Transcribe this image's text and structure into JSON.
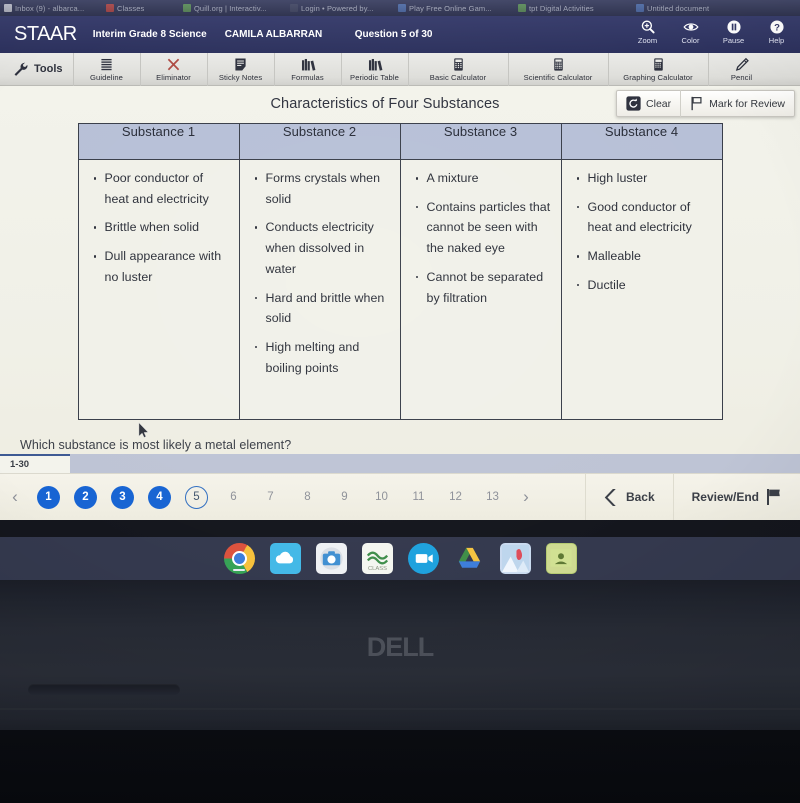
{
  "browser": {
    "tabs": [
      {
        "label": "Inbox (9) - albarca...",
        "favicon": "mail-icon",
        "favcolor": "white"
      },
      {
        "label": "Classes",
        "favicon": "classes-icon",
        "favcolor": "red"
      },
      {
        "label": "Quill.org | Interactiv...",
        "favicon": "quill-icon",
        "favcolor": "green"
      },
      {
        "label": "Login • Powered by...",
        "favicon": "login-icon",
        "favcolor": "dark"
      },
      {
        "label": "Play Free Online Gam...",
        "favicon": "play-icon",
        "favcolor": "blue"
      },
      {
        "label": "tpt Digital Activities",
        "favicon": "tpt-icon",
        "favcolor": "green"
      },
      {
        "label": "Untitled document",
        "favicon": "docs-icon",
        "favcolor": "blue"
      }
    ]
  },
  "header": {
    "logo": "STAAR",
    "test_name": "Interim Grade 8 Science",
    "student_name": "CAMILA ALBARRAN",
    "question_counter": "Question 5 of 30",
    "tools": [
      {
        "label": "Zoom",
        "icon": "zoom-in-icon"
      },
      {
        "label": "Color",
        "icon": "eye-color-icon"
      },
      {
        "label": "Pause",
        "icon": "pause-icon"
      },
      {
        "label": "Help",
        "icon": "question-mark-icon"
      }
    ]
  },
  "toolsbar": {
    "tools_label": "Tools",
    "tools_icon": "wrench-icon",
    "items": [
      {
        "label": "Guideline",
        "icon": "guideline-icon",
        "wide": false
      },
      {
        "label": "Eliminator",
        "icon": "eliminator-x-icon",
        "wide": false
      },
      {
        "label": "Sticky Notes",
        "icon": "sticky-notes-icon",
        "wide": false
      },
      {
        "label": "Formulas",
        "icon": "formulas-icon",
        "wide": false
      },
      {
        "label": "Periodic Table",
        "icon": "periodic-table-icon",
        "wide": false
      },
      {
        "label": "Basic Calculator",
        "icon": "calculator-icon",
        "wide": true
      },
      {
        "label": "Scientific Calculator",
        "icon": "calculator-icon",
        "wide": true
      },
      {
        "label": "Graphing Calculator",
        "icon": "calculator-icon",
        "wide": true
      },
      {
        "label": "Pencil",
        "icon": "pencil-icon",
        "wide": false
      }
    ]
  },
  "markbox": {
    "clear_label": "Clear",
    "clear_icon": "undo-circle-icon",
    "mark_label": "Mark for Review",
    "mark_icon": "flag-icon"
  },
  "stimulus": {
    "title": "Characteristics of Four Substances",
    "columns": [
      {
        "header": "Substance 1",
        "items": [
          "Poor conductor of heat and electricity",
          "Brittle when solid",
          "Dull appearance with no luster"
        ]
      },
      {
        "header": "Substance 2",
        "items": [
          "Forms crystals when solid",
          "Conducts electricity when dissolved in water",
          "Hard and brittle when solid",
          "High melting and boiling points"
        ]
      },
      {
        "header": "Substance 3",
        "items": [
          "A mixture",
          "Contains particles that cannot be seen with the naked eye",
          "Cannot be separated by filtration"
        ]
      },
      {
        "header": "Substance 4",
        "items": [
          "High luster",
          "Good conductor of heat and electricity",
          "Malleable",
          "Ductile"
        ]
      }
    ]
  },
  "question": {
    "stem": "Which substance is most likely a metal element?"
  },
  "itemtab": {
    "label": "1-30"
  },
  "pager": {
    "prev_icon": "chevron-left-icon",
    "next_icon": "chevron-right-icon",
    "numbers": [
      {
        "label": "1",
        "state": "answered"
      },
      {
        "label": "2",
        "state": "answered"
      },
      {
        "label": "3",
        "state": "answered"
      },
      {
        "label": "4",
        "state": "answered"
      },
      {
        "label": "5",
        "state": "current"
      },
      {
        "label": "6",
        "state": "unanswered"
      },
      {
        "label": "7",
        "state": "unanswered"
      },
      {
        "label": "8",
        "state": "unanswered"
      },
      {
        "label": "9",
        "state": "unanswered"
      },
      {
        "label": "10",
        "state": "unanswered"
      },
      {
        "label": "11",
        "state": "unanswered"
      },
      {
        "label": "12",
        "state": "unanswered"
      },
      {
        "label": "13",
        "state": "unanswered"
      }
    ],
    "back_label": "Back",
    "back_icon": "chevron-left-bold-icon",
    "review_label": "Review/End",
    "review_icon": "flag-filled-icon"
  },
  "shelf": {
    "icons": [
      "chrome-icon",
      "cloud-app-icon",
      "camera-icon",
      "notes-app-icon",
      "video-call-icon",
      "google-drive-icon",
      "photo-app-icon",
      "google-classroom-icon"
    ]
  },
  "laptop": {
    "brand": "DELL"
  },
  "colors": {
    "header_blue": "#343968",
    "accent_blue": "#1565d8",
    "table_header": "#b5bfd6",
    "page_bg": "#efefe7",
    "shelf": "#353a50"
  }
}
